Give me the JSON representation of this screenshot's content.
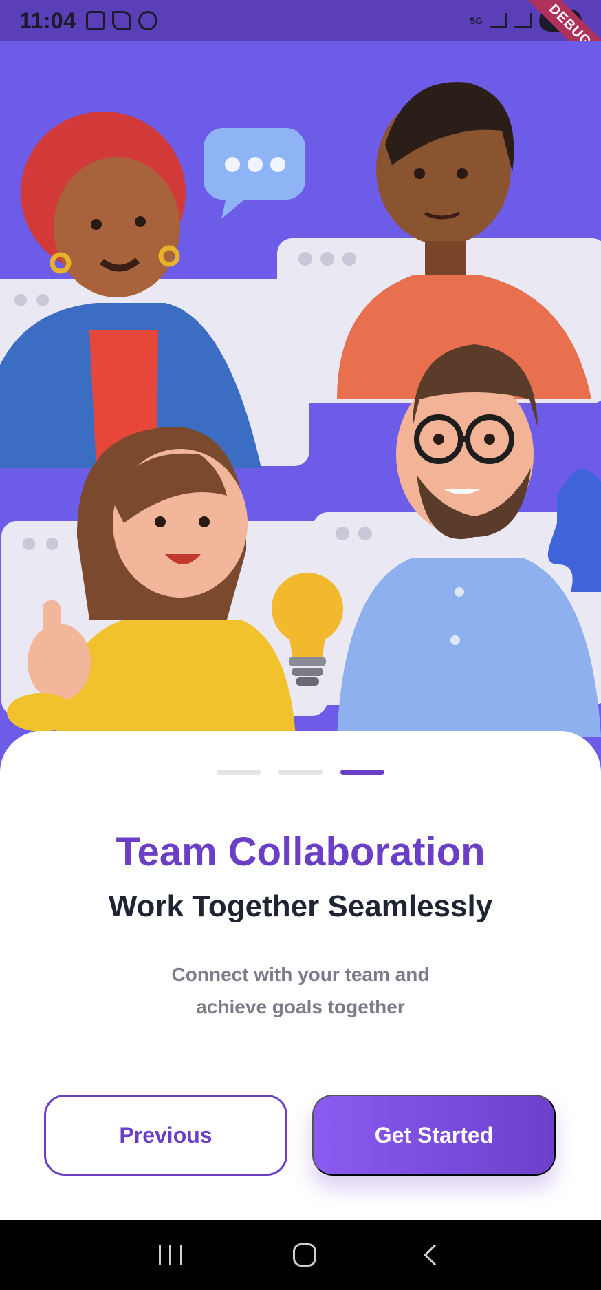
{
  "status_bar": {
    "time": "11:04",
    "network": "5G",
    "debug_banner": "DEBUG"
  },
  "onboarding": {
    "page_indicator": {
      "total": 3,
      "active_index": 2
    },
    "title": "Team Collaboration",
    "subtitle": "Work Together Seamlessly",
    "description": "Connect with your team and achieve goals together",
    "previous_label": "Previous",
    "next_label": "Get Started"
  },
  "colors": {
    "accent": "#6a3fc6",
    "hero_bg": "#6c5ce7",
    "status_bar": "#5a3fb8"
  },
  "hero": {
    "icons": [
      "chat-bubble-icon",
      "lightbulb-icon",
      "puzzle-piece-icon"
    ]
  }
}
